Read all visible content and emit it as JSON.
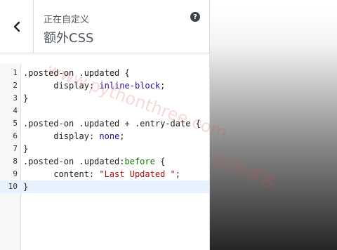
{
  "header": {
    "back_icon": "chevron-left-icon",
    "subtitle": "正在自定义",
    "title": "额外CSS",
    "help_icon": "question-icon",
    "help_glyph": "?"
  },
  "editor": {
    "active_line": 10,
    "lines": [
      {
        "n": "1",
        "text": ".posted-on .updated {"
      },
      {
        "n": "2",
        "text": "      display: inline-block;"
      },
      {
        "n": "3",
        "text": "}"
      },
      {
        "n": "4",
        "text": ""
      },
      {
        "n": "5",
        "text": ".posted-on .updated + .entry-date {"
      },
      {
        "n": "6",
        "text": "      display: none;"
      },
      {
        "n": "7",
        "text": "}"
      },
      {
        "n": "8",
        "text": ".posted-on .updated:before {"
      },
      {
        "n": "9",
        "text": "      content: \"Last Updated \";"
      },
      {
        "n": "10",
        "text": "}"
      }
    ]
  },
  "watermark": {
    "line1": "www.pythonthree.com",
    "line2": "晓得博客"
  },
  "colors": {
    "accent_active_line": "#e8f2ff",
    "keyword": "#117700",
    "value": "#221199",
    "string": "#aa1111"
  }
}
